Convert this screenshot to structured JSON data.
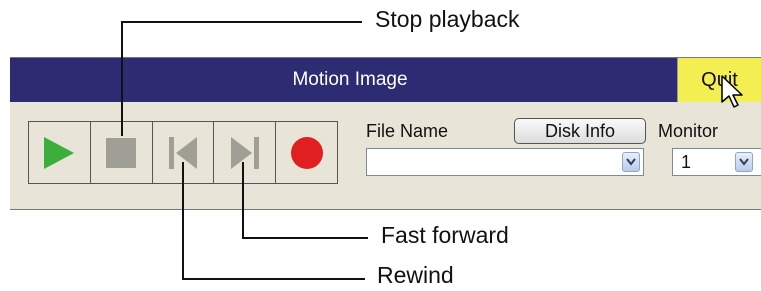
{
  "callouts": {
    "stop": "Stop playback",
    "fast_forward": "Fast forward",
    "rewind": "Rewind"
  },
  "window": {
    "title": "Motion Image",
    "quit_label": "Quit"
  },
  "playback_buttons": [
    {
      "name": "play",
      "icon": "play-icon",
      "color": "#3cae3a"
    },
    {
      "name": "stop",
      "icon": "stop-icon",
      "color": "#a09f96"
    },
    {
      "name": "rewind",
      "icon": "skip-back-icon",
      "color": "#a09f96"
    },
    {
      "name": "fast-forward",
      "icon": "skip-forward-icon",
      "color": "#a09f96"
    },
    {
      "name": "record",
      "icon": "record-icon",
      "color": "#e02020"
    }
  ],
  "file": {
    "label": "File Name",
    "value": ""
  },
  "disk_info_label": "Disk Info",
  "monitor": {
    "label": "Monitor",
    "value": "1"
  },
  "colors": {
    "titlebar": "#2d2b72",
    "quit": "#f3ee52",
    "panel": "#e8e4d8"
  }
}
